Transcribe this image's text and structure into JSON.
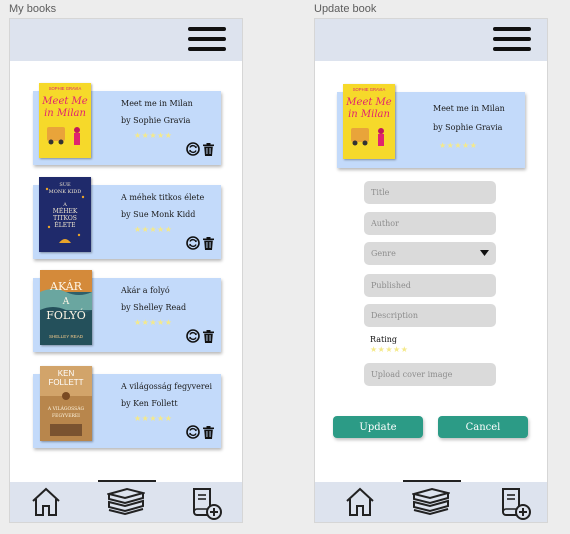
{
  "frames": {
    "left_label": "My books",
    "right_label": "Update book"
  },
  "books": [
    {
      "title": "Meet me in Milan",
      "author": "by Sophie Gravia",
      "rating_stars": "★★★★★",
      "cover": {
        "top": "SOPHIE GRAVIA",
        "line1": "Meet Me",
        "line2": "in Milan"
      }
    },
    {
      "title": "A méhek titkos élete",
      "author": "by Sue Monk Kidd",
      "rating_stars": "★★★★★",
      "cover": {
        "top1": "SUE",
        "top2": "MONK KIDD",
        "line1": "A",
        "line2": "MÉHEK",
        "line3": "TITKOS",
        "line4": "ÉLETE"
      }
    },
    {
      "title": "Akár a folyó",
      "author": "by Shelley Read",
      "rating_stars": "★★★★★",
      "cover": {
        "line1": "AKÁR",
        "line2": "A",
        "line3": "FOLYÓ",
        "bottom": "SHELLEY READ"
      }
    },
    {
      "title": "A világosság fegyverei",
      "author": "by Ken Follett",
      "rating_stars": "★★★★★",
      "cover": {
        "top1": "KEN",
        "top2": "FOLLETT",
        "line1": "A VILÁGOSSÁG",
        "line2": "FEGYVEREI"
      }
    }
  ],
  "update_form": {
    "book_title": "Meet me in Milan",
    "book_author": "by Sophie Gravia",
    "rating_stars": "★★★★★",
    "title_placeholder": "Title",
    "author_placeholder": "Author",
    "genre_placeholder": "Genre",
    "published_placeholder": "Published",
    "description_placeholder": "Description",
    "rating_label": "Rating",
    "rating_input_stars": "★★★★★",
    "upload_placeholder": "Upload cover image",
    "update_button": "Update",
    "cancel_button": "Cancel"
  },
  "icons": {
    "menu": "hamburger-menu-icon",
    "home": "home-icon",
    "library": "books-stack-icon",
    "add_book": "add-book-icon",
    "edit": "refresh-edit-icon",
    "delete": "trash-icon"
  },
  "colors": {
    "topbar": "#dde3ee",
    "card": "#c3dafa",
    "stars": "#f4e98a",
    "button": "#2c9b86",
    "field": "#dadada"
  }
}
